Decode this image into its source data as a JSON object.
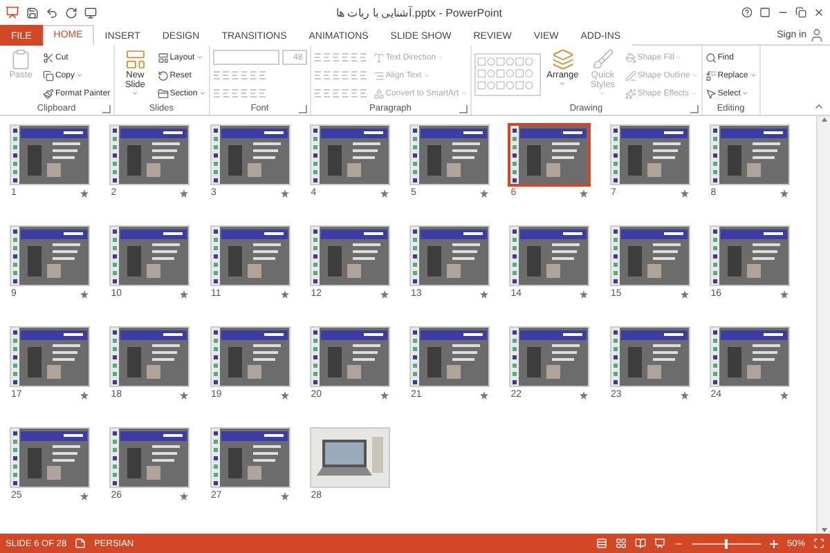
{
  "window": {
    "title": "آشنایی با ربات ها.pptx - PowerPoint",
    "sign_in": "Sign in"
  },
  "tabs": [
    {
      "label": "FILE",
      "kind": "file",
      "selected": false
    },
    {
      "label": "HOME",
      "kind": "tab",
      "selected": true
    },
    {
      "label": "INSERT",
      "kind": "tab",
      "selected": false
    },
    {
      "label": "DESIGN",
      "kind": "tab",
      "selected": false
    },
    {
      "label": "TRANSITIONS",
      "kind": "tab",
      "selected": false
    },
    {
      "label": "ANIMATIONS",
      "kind": "tab",
      "selected": false
    },
    {
      "label": "SLIDE SHOW",
      "kind": "tab",
      "selected": false
    },
    {
      "label": "REVIEW",
      "kind": "tab",
      "selected": false
    },
    {
      "label": "VIEW",
      "kind": "tab",
      "selected": false
    },
    {
      "label": "ADD-INS",
      "kind": "tab",
      "selected": false
    }
  ],
  "ribbon": [
    {
      "label": "Clipboard",
      "launcher": true,
      "items": [
        {
          "kind": "large",
          "label": "Paste",
          "disabled": true
        },
        {
          "kind": "small",
          "label": "Cut",
          "disabled": false
        },
        {
          "kind": "small",
          "label": "Copy",
          "disabled": false,
          "dropdown": true
        },
        {
          "kind": "small",
          "label": "Format Painter",
          "disabled": false
        }
      ]
    },
    {
      "label": "Slides",
      "launcher": false,
      "items": [
        {
          "kind": "large",
          "label": "New Slide",
          "disabled": false,
          "dropdown": true
        },
        {
          "kind": "small",
          "label": "Layout",
          "disabled": false,
          "dropdown": true
        },
        {
          "kind": "small",
          "label": "Reset",
          "disabled": false
        },
        {
          "kind": "small",
          "label": "Section",
          "disabled": false,
          "dropdown": true
        }
      ]
    },
    {
      "label": "Font",
      "launcher": true,
      "items": [
        {
          "kind": "fontbox",
          "value": "48",
          "disabled": true
        },
        {
          "kind": "tools",
          "disabled": true
        },
        {
          "kind": "tools",
          "disabled": true
        }
      ]
    },
    {
      "label": "Paragraph",
      "launcher": true,
      "items": [
        {
          "kind": "tools",
          "disabled": true
        },
        {
          "kind": "tools",
          "disabled": true
        },
        {
          "kind": "tools",
          "disabled": true
        },
        {
          "kind": "small",
          "label": "Text Direction",
          "disabled": true,
          "dropdown": true
        },
        {
          "kind": "small",
          "label": "Align Text",
          "disabled": true,
          "dropdown": true
        },
        {
          "kind": "small",
          "label": "Convert to SmartArt",
          "disabled": true,
          "dropdown": true
        }
      ]
    },
    {
      "label": "Drawing",
      "launcher": true,
      "items": [
        {
          "kind": "gallery",
          "disabled": true
        },
        {
          "kind": "large",
          "label": "Arrange",
          "disabled": false,
          "dropdown": true
        },
        {
          "kind": "large",
          "label": "Quick Styles",
          "disabled": true,
          "dropdown": true
        },
        {
          "kind": "small",
          "label": "Shape Fill",
          "disabled": true,
          "dropdown": true
        },
        {
          "kind": "small",
          "label": "Shape Outline",
          "disabled": true,
          "dropdown": true
        },
        {
          "kind": "small",
          "label": "Shape Effects",
          "disabled": true,
          "dropdown": true
        }
      ]
    },
    {
      "label": "Editing",
      "launcher": false,
      "items": [
        {
          "kind": "small",
          "label": "Find",
          "disabled": false
        },
        {
          "kind": "small",
          "label": "Replace",
          "disabled": false,
          "dropdown": true
        },
        {
          "kind": "small",
          "label": "Select",
          "disabled": false,
          "dropdown": true
        }
      ]
    }
  ],
  "slides": [
    {
      "number": "1",
      "kind": "template",
      "selected": false,
      "starred": true
    },
    {
      "number": "2",
      "kind": "template",
      "selected": false,
      "starred": true
    },
    {
      "number": "3",
      "kind": "template",
      "selected": false,
      "starred": true
    },
    {
      "number": "4",
      "kind": "template",
      "selected": false,
      "starred": true
    },
    {
      "number": "5",
      "kind": "template",
      "selected": false,
      "starred": true
    },
    {
      "number": "6",
      "kind": "template",
      "selected": true,
      "starred": true
    },
    {
      "number": "7",
      "kind": "template",
      "selected": false,
      "starred": true
    },
    {
      "number": "8",
      "kind": "template",
      "selected": false,
      "starred": true
    },
    {
      "number": "9",
      "kind": "template",
      "selected": false,
      "starred": true
    },
    {
      "number": "10",
      "kind": "template",
      "selected": false,
      "starred": true
    },
    {
      "number": "11",
      "kind": "template",
      "selected": false,
      "starred": true
    },
    {
      "number": "12",
      "kind": "template",
      "selected": false,
      "starred": true
    },
    {
      "number": "13",
      "kind": "template",
      "selected": false,
      "starred": true
    },
    {
      "number": "14",
      "kind": "template",
      "selected": false,
      "starred": true
    },
    {
      "number": "15",
      "kind": "template",
      "selected": false,
      "starred": true
    },
    {
      "number": "16",
      "kind": "template",
      "selected": false,
      "starred": true
    },
    {
      "number": "17",
      "kind": "template",
      "selected": false,
      "starred": true
    },
    {
      "number": "18",
      "kind": "template",
      "selected": false,
      "starred": true
    },
    {
      "number": "19",
      "kind": "template",
      "selected": false,
      "starred": true
    },
    {
      "number": "20",
      "kind": "template",
      "selected": false,
      "starred": true
    },
    {
      "number": "21",
      "kind": "template",
      "selected": false,
      "starred": true
    },
    {
      "number": "22",
      "kind": "template",
      "selected": false,
      "starred": true
    },
    {
      "number": "23",
      "kind": "template",
      "selected": false,
      "starred": true
    },
    {
      "number": "24",
      "kind": "template",
      "selected": false,
      "starred": true
    },
    {
      "number": "25",
      "kind": "template",
      "selected": false,
      "starred": true
    },
    {
      "number": "26",
      "kind": "template",
      "selected": false,
      "starred": true
    },
    {
      "number": "27",
      "kind": "template",
      "selected": false,
      "starred": true
    },
    {
      "number": "28",
      "kind": "photo",
      "selected": false,
      "starred": false
    }
  ],
  "status_bar": {
    "slide": "SLIDE 6 OF 28",
    "language": "PERSIAN",
    "zoom": "50%",
    "zoom_level": {
      "level": 0.5
    }
  }
}
